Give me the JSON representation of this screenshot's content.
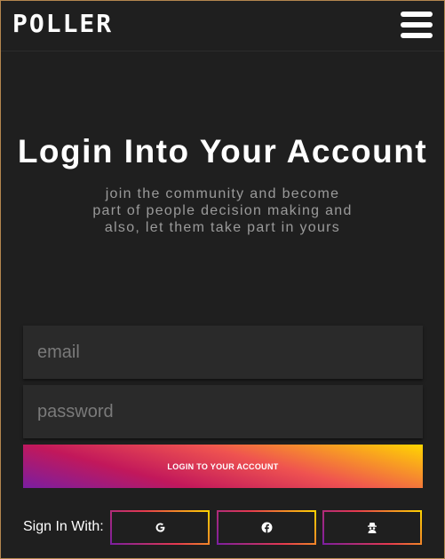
{
  "header": {
    "logo_text": "POLLER",
    "menu_icon": "hamburger-menu-icon"
  },
  "main": {
    "title": "Login Into Your Account",
    "subtitle": "join the community and become part of people decision making and also, let them take part in yours"
  },
  "form": {
    "email_placeholder": "email",
    "email_value": "",
    "password_placeholder": "password",
    "password_value": "",
    "login_label": "LOGIN TO YOUR ACCOUNT"
  },
  "social": {
    "label": "Sign In With:",
    "buttons": [
      {
        "icon": "google-icon"
      },
      {
        "icon": "facebook-icon"
      },
      {
        "icon": "anonymous-user-icon"
      }
    ]
  },
  "colors": {
    "background": "#1f1f1f",
    "field_background": "#2a2a2a",
    "gradient_start": "#7a1ea1",
    "gradient_mid": "#e53950",
    "gradient_end": "#ffd600",
    "subtitle_text": "#9a9a9a"
  }
}
